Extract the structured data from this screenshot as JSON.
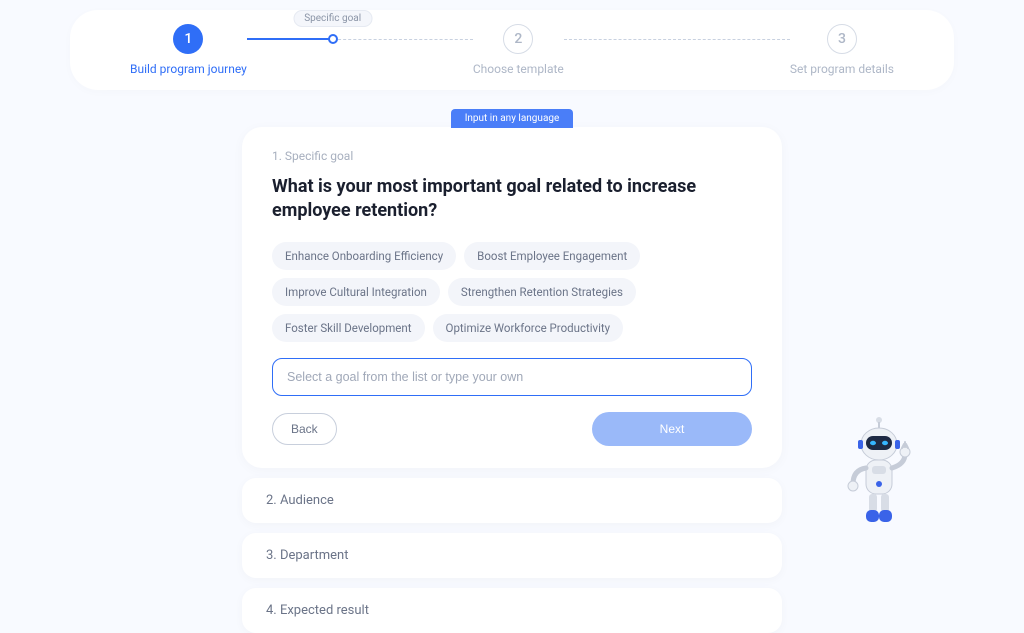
{
  "stepper": {
    "steps": [
      {
        "num": "1",
        "label": "Build program journey",
        "active": true
      },
      {
        "num": "2",
        "label": "Choose template",
        "active": false
      },
      {
        "num": "3",
        "label": "Set program details",
        "active": false
      }
    ],
    "substep": "Specific goal"
  },
  "lang_pill": "Input in any language",
  "card": {
    "step_label": "1. Specific goal",
    "title": "What is your most important goal related to increase employee retention?",
    "chips": [
      "Enhance Onboarding Efficiency",
      "Boost Employee Engagement",
      "Improve Cultural Integration",
      "Strengthen Retention Strategies",
      "Foster Skill Development",
      "Optimize Workforce Productivity"
    ],
    "input_placeholder": "Select a goal from the list or type your own",
    "input_value": "",
    "back": "Back",
    "next": "Next"
  },
  "collapsed": [
    "2. Audience",
    "3. Department",
    "4. Expected result"
  ]
}
